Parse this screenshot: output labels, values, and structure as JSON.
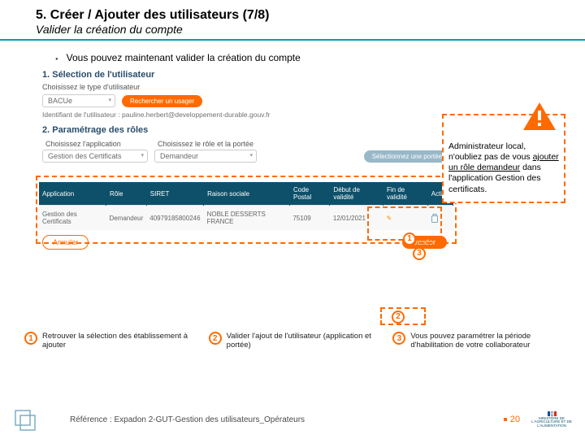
{
  "header": {
    "title": "5. Créer / Ajouter des utilisateurs (7/8)",
    "subtitle": "Valider la création du compte"
  },
  "bullet": "Vous pouvez maintenant valider la création du compte",
  "app": {
    "step1_title": "1. Sélection de l'utilisateur",
    "choose_type": "Choisissez le type d'utilisateur",
    "type_value": "BACUe",
    "search_btn": "Rechercher un usager",
    "email_line": "Identifiant de l'utilisateur : pauline.herbert@developpement-durable.gouv.fr",
    "step2_title": "2. Paramétrage des rôles",
    "choose_app": "Choisissez l'application",
    "app_value": "Gestion des Certificats",
    "choose_role": "Choisissez le rôle et la portée",
    "role_value": "Demandeur",
    "select_scope_btn": "Sélectionnez une portée",
    "table": {
      "headers": [
        "Application",
        "Rôle",
        "SIRET",
        "Raison sociale",
        "Code Postal",
        "Début de validité",
        "Fin de validité",
        "Action"
      ],
      "row": {
        "app": "Gestion des Certificats",
        "role": "Demandeur",
        "siret": "40979185800246",
        "raison": "NOBLE DESSERTS FRANCE",
        "cp": "75109",
        "debut": "12/01/2021",
        "fin": "✎"
      }
    },
    "cancel_btn": "Annuler",
    "validate_btn": "Valider"
  },
  "warning": {
    "line1": "Administrateur local, n'oubliez pas de vous ",
    "underline": "ajouter un rôle demandeur",
    "line2": " dans l'application Gestion des certificats."
  },
  "legend": {
    "i1": "Retrouver la sélection des établissement à ajouter",
    "i2": "Valider l'ajout de l'utilisateur (application et portée)",
    "i3": "Vous pouvez paramétrer la période d'habilitation de votre collaborateur"
  },
  "footer": {
    "ref": "Référence : Expadon 2-GUT-Gestion des utilisateurs_Opérateurs",
    "page": "20",
    "ministry": "MINISTÈRE DE L'AGRICULTURE ET DE L'ALIMENTATION"
  },
  "badges": {
    "n1": "1",
    "n2": "2",
    "n3": "3"
  }
}
